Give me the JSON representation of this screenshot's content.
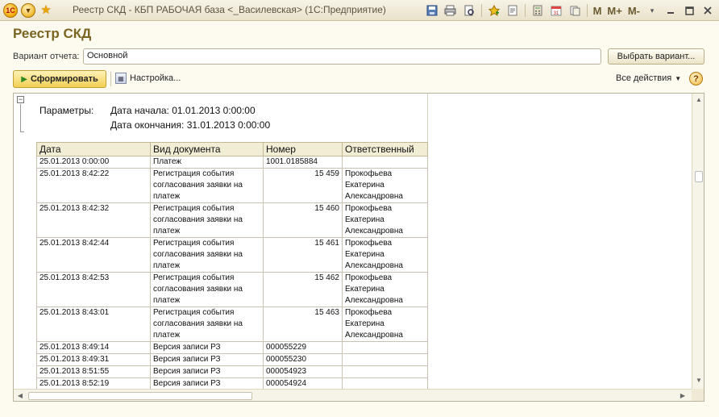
{
  "window": {
    "title": "Реестр СКД - КБП РАБОЧАЯ база <_Василевская> (1С:Предприятие)",
    "logo_text": "1С",
    "memory_buttons": [
      "M",
      "M+",
      "M-"
    ]
  },
  "form": {
    "heading": "Реестр СКД",
    "variant_label": "Вариант отчета:",
    "variant_value": "Основной",
    "choose_variant_button": "Выбрать вариант...",
    "generate_button": "Сформировать",
    "settings_button": "Настройка...",
    "all_actions": "Все действия",
    "help": "?"
  },
  "report": {
    "params_label": "Параметры:",
    "start_date": "Дата начала: 01.01.2013 0:00:00",
    "end_date": "Дата окончания: 31.01.2013 0:00:00",
    "columns": [
      "Дата",
      "Вид документа",
      "Номер",
      "Ответственный"
    ],
    "rows": [
      {
        "date": "25.01.2013 0:00:00",
        "doc": "Платеж",
        "num": "1001.0185884",
        "num_align": "left",
        "resp": ""
      },
      {
        "date": "25.01.2013 8:42:22",
        "doc": "Регистрация события согласования заявки на платеж",
        "num": "15 459",
        "num_align": "right",
        "resp": "Прокофьева Екатерина Александровна"
      },
      {
        "date": "25.01.2013 8:42:32",
        "doc": "Регистрация события согласования заявки на платеж",
        "num": "15 460",
        "num_align": "right",
        "resp": "Прокофьева Екатерина Александровна"
      },
      {
        "date": "25.01.2013 8:42:44",
        "doc": "Регистрация события согласования заявки на платеж",
        "num": "15 461",
        "num_align": "right",
        "resp": "Прокофьева Екатерина Александровна"
      },
      {
        "date": "25.01.2013 8:42:53",
        "doc": "Регистрация события согласования заявки на платеж",
        "num": "15 462",
        "num_align": "right",
        "resp": "Прокофьева Екатерина Александровна"
      },
      {
        "date": "25.01.2013 8:43:01",
        "doc": "Регистрация события согласования заявки на платеж",
        "num": "15 463",
        "num_align": "right",
        "resp": "Прокофьева Екатерина Александровна"
      },
      {
        "date": "25.01.2013 8:49:14",
        "doc": "Версия записи РЗ",
        "num": "000055229",
        "num_align": "left",
        "resp": ""
      },
      {
        "date": "25.01.2013 8:49:31",
        "doc": "Версия записи РЗ",
        "num": "000055230",
        "num_align": "left",
        "resp": ""
      },
      {
        "date": "25.01.2013 8:51:55",
        "doc": "Версия записи РЗ",
        "num": "000054923",
        "num_align": "left",
        "resp": ""
      },
      {
        "date": "25.01.2013 8:52:19",
        "doc": "Версия записи РЗ",
        "num": "000054924",
        "num_align": "left",
        "resp": ""
      }
    ]
  }
}
